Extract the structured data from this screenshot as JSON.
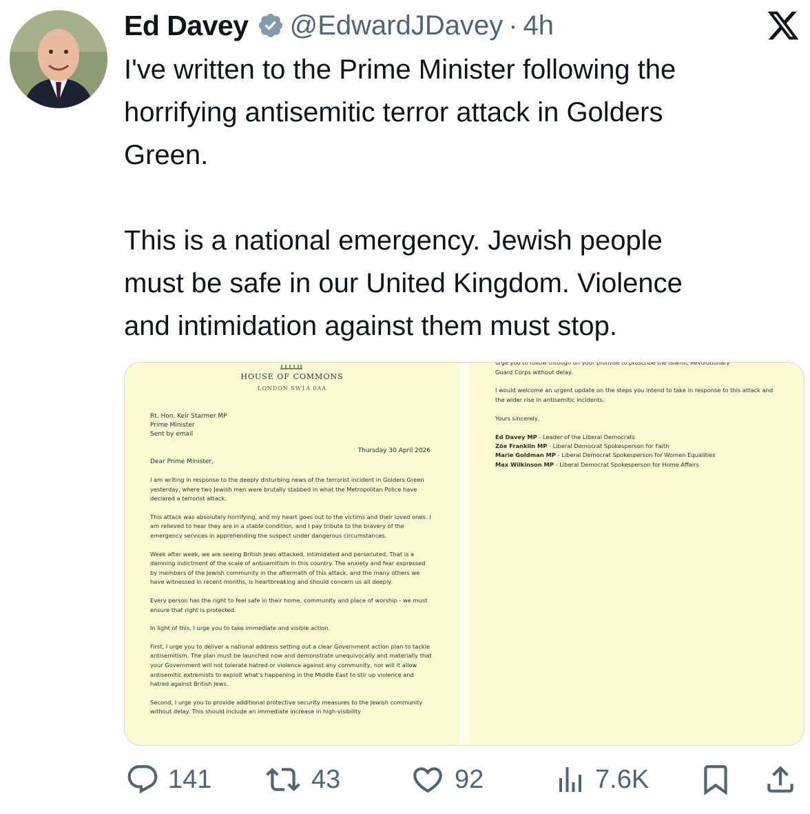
{
  "tweet": {
    "author_name": "Ed Davey",
    "handle": "@EdwardJDavey",
    "separator": "·",
    "time": "4h",
    "paragraph1": "I've written to the Prime Minister following the\nhorrifying antisemitic terror attack in Golders\nGreen.",
    "paragraph2": "This is a national emergency. Jewish people\nmust be safe in our United Kingdom. Violence\nand intimidation against them must stop."
  },
  "letter_page1": {
    "org": "HOUSE OF COMMONS",
    "org_address": "LONDON SW1A 0AA",
    "recipient_line1": "Rt. Hon. Keir Starmer MP",
    "recipient_line2": "Prime Minister",
    "recipient_line3": "Sent by email",
    "date": "Thursday 30 April 2026",
    "salutation": "Dear Prime Minister,",
    "para1": "I am writing in response to the deeply disturbing news of the terrorist incident in Golders Green yesterday, where two Jewish men were brutally stabbed in what the Metropolitan Police have declared a terrorist attack.",
    "para2": "This attack was absolutely horrifying, and my heart goes out to the victims and their loved ones. I am relieved to hear they are in a stable condition, and I pay tribute to the bravery of the emergency services in apprehending the suspect under dangerous circumstances.",
    "para3": "Week after week, we are seeing British Jews attacked, intimidated and persecuted. That is a damning indictment of the scale of antisemitism in this country. The anxiety and fear expressed by members of the Jewish community in the aftermath of this attack, and the many others we have witnessed in recent months, is heartbreaking and should concern us all deeply.",
    "para4": "Every person has the right to feel safe in their home, community and place of worship - we must ensure that right is protected.",
    "para5": "In light of this, I urge you to take immediate and visible action.",
    "para6": "First, I urge you to deliver a national address setting out a clear Government action plan to tackle antisemitism. The plan must be launched now and demonstrate unequivocally and materially that your Government will not tolerate hatred or violence against any community, nor will it allow antisemitic extremists to exploit what's happening in the Middle East to stir up violence and hatred against British Jews.",
    "para7": "Second, I urge you to provide additional protective security measures to the Jewish community without delay. This should include an immediate increase in high-visibility"
  },
  "letter_page2": {
    "cut_line": "urge you to follow through on your promise to proscribe the Islamic Revolutionary",
    "line_guard": "Guard Corps without delay.",
    "para_update": "I would welcome an urgent update on the steps you intend to take in response to this attack and the wider rise in antisemitic incidents.",
    "closing": "Yours sincerely,",
    "signatories": [
      {
        "name": "Ed Davey MP",
        "role": " - Leader of the Liberal Democrats"
      },
      {
        "name": "Zöe Franklin MP",
        "role": " - Liberal Democrat Spokesperson for Faith"
      },
      {
        "name": "Marie Goldman MP",
        "role": " - Liberal Democrat Spokesperson for Women Equalities"
      },
      {
        "name": "Max Wilkinson MP",
        "role": " - Liberal Democrat Spokesperson for Home Affairs"
      }
    ]
  },
  "actions": {
    "replies": "141",
    "reposts": "43",
    "likes": "92",
    "views": "7.6K"
  },
  "icons": {
    "verified": "verified-badge-icon",
    "brand": "x-logo-icon",
    "reply": "reply-icon",
    "repost": "repost-icon",
    "like": "heart-icon",
    "views": "views-icon",
    "bookmark": "bookmark-icon",
    "share": "share-icon"
  },
  "colors": {
    "secondary_text": "#536471",
    "verified_badge": "#829aab",
    "letter_paper": "#fafbd3"
  }
}
